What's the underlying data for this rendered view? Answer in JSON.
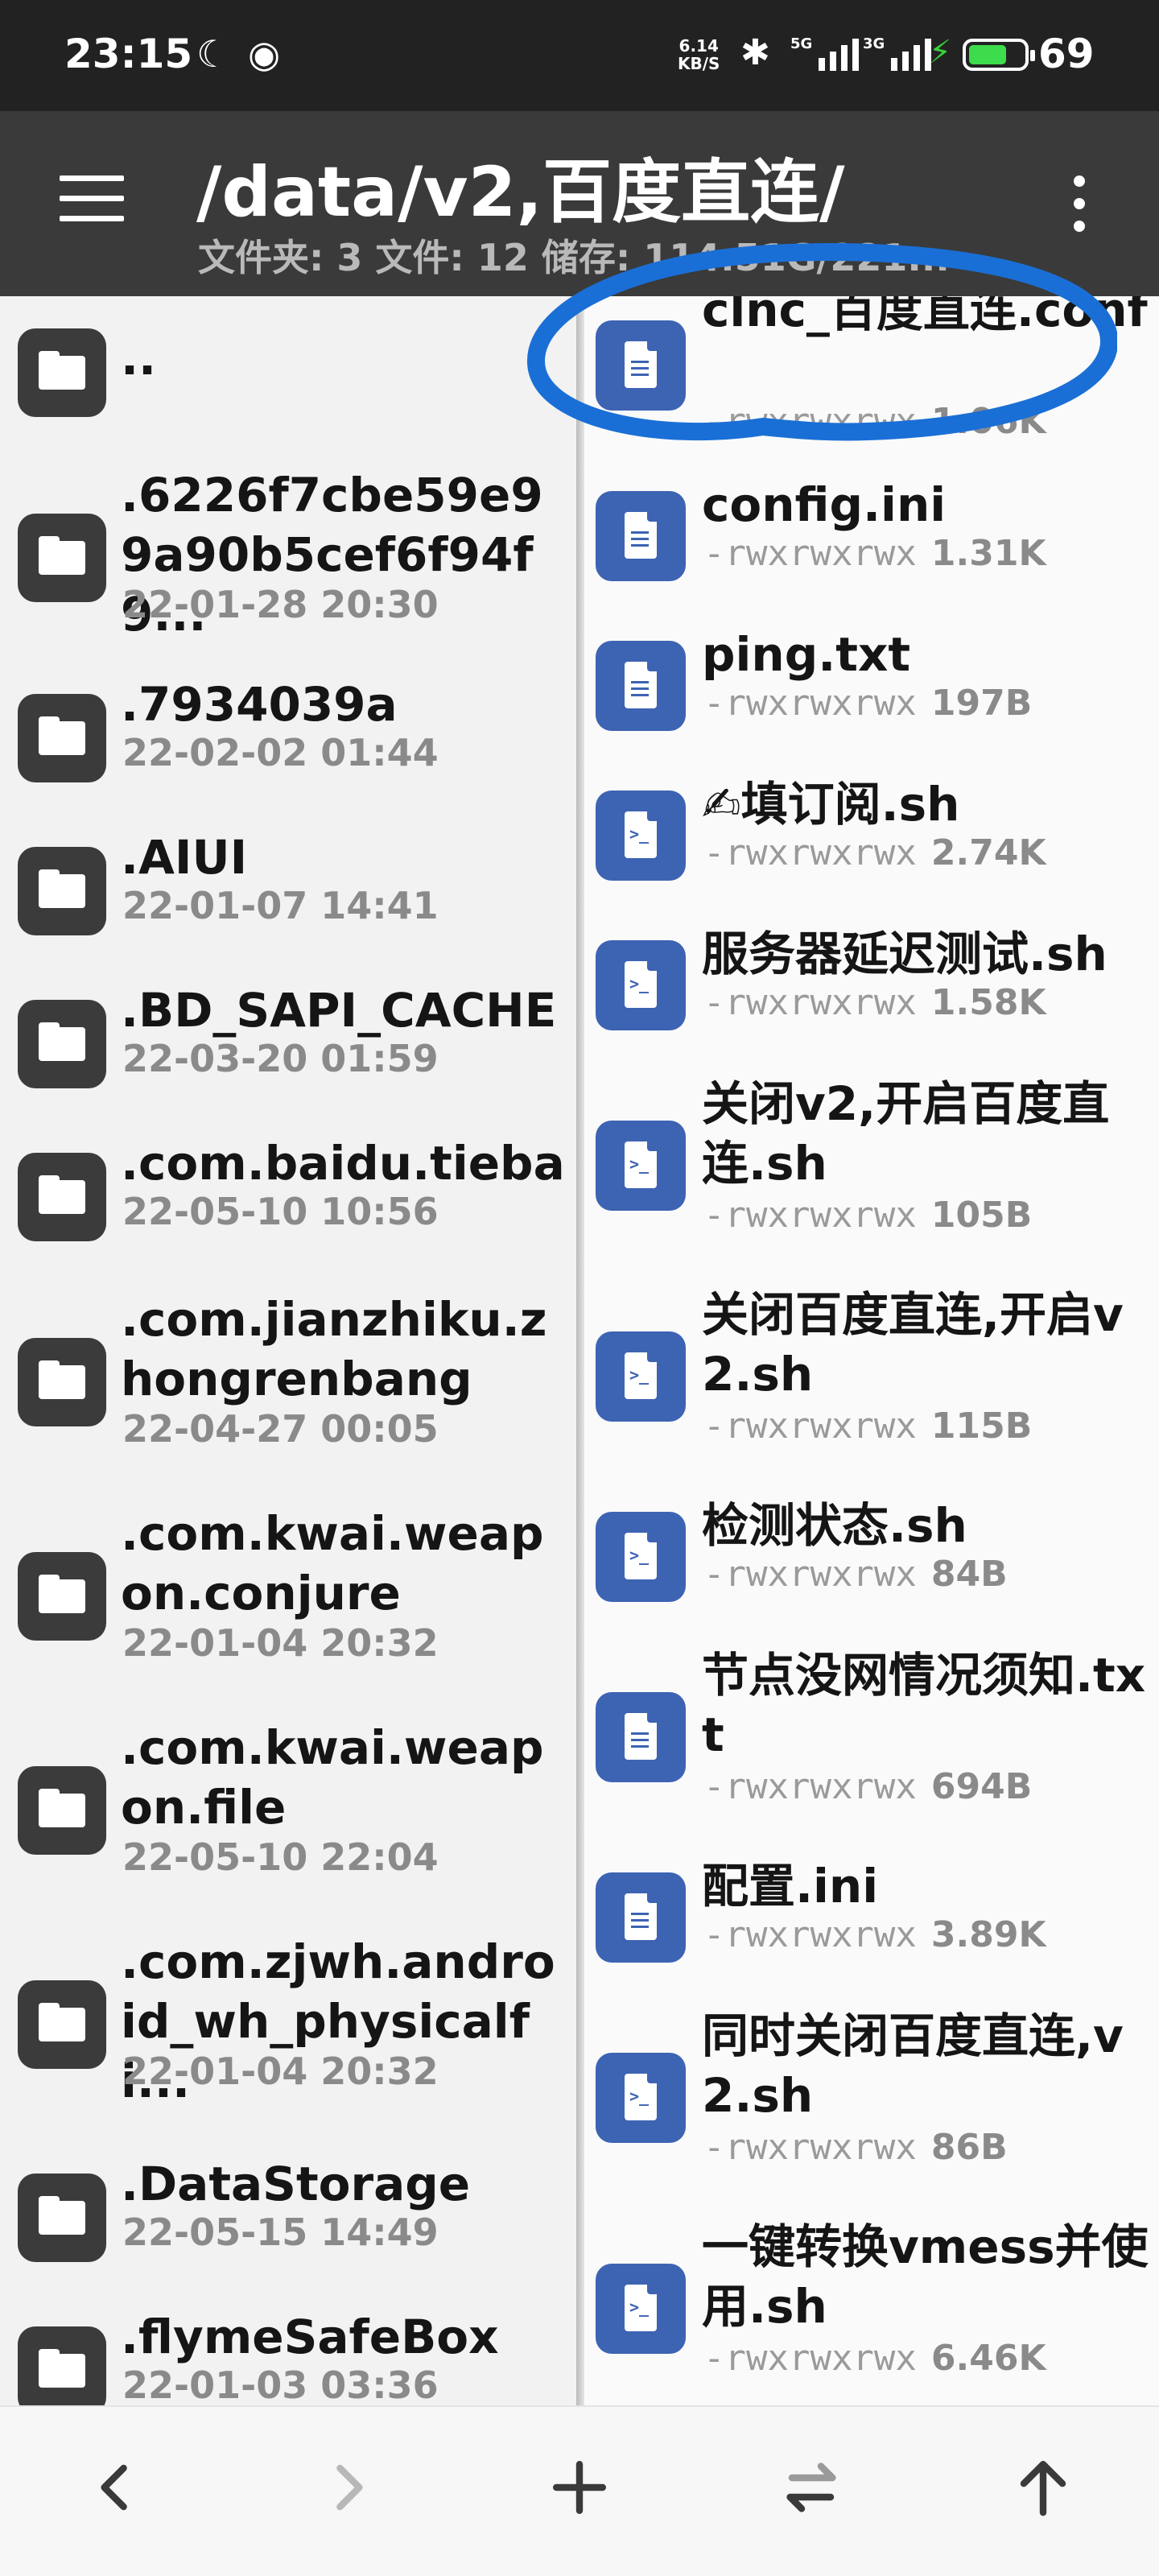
{
  "status_bar": {
    "time": "23:15",
    "net_speed_value": "6.14",
    "net_speed_unit": "KB/S",
    "sim1_label": "5G",
    "sim2_label": "3G",
    "battery_percent": "69",
    "battery_level": 0.69,
    "icons": [
      "moon-icon",
      "hotspot-icon",
      "bluetooth-icon",
      "signal-icon",
      "charging-icon",
      "battery-icon"
    ]
  },
  "app_bar": {
    "title": "/data/v2,百度直连/",
    "subtitle": "文件夹: 3  文件: 12  储存: 114.51G/221..."
  },
  "left_pane": {
    "items": [
      {
        "name": "..",
        "date": ""
      },
      {
        "name": ".6226f7cbe59e99a90b5cef6f94f9...",
        "date": "22-01-28 20:30"
      },
      {
        "name": ".7934039a",
        "date": "22-02-02 01:44"
      },
      {
        "name": ".AIUI",
        "date": "22-01-07 14:41"
      },
      {
        "name": ".BD_SAPI_CACHE",
        "date": "22-03-20 01:59"
      },
      {
        "name": ".com.baidu.tieba",
        "date": "22-05-10 10:56"
      },
      {
        "name": ".com.jianzhiku.zhongrenbang",
        "date": "22-04-27 00:05"
      },
      {
        "name": ".com.kwai.weapon.conjure",
        "date": "22-01-04 20:32"
      },
      {
        "name": ".com.kwai.weapon.file",
        "date": "22-05-10 22:04"
      },
      {
        "name": ".com.zjwh.android_wh_physicalfi...",
        "date": "22-01-04 20:32"
      },
      {
        "name": ".DataStorage",
        "date": "22-05-15 14:49"
      },
      {
        "name": ".flymeSafeBox",
        "date": "22-01-03 03:36"
      }
    ]
  },
  "right_pane": {
    "items": [
      {
        "name": "clnc_百度直连.conf",
        "perm": "-rwxrwxrwx",
        "size": "1.06K",
        "kind": "text"
      },
      {
        "name": "config.ini",
        "perm": "-rwxrwxrwx",
        "size": "1.31K",
        "kind": "text"
      },
      {
        "name": "ping.txt",
        "perm": "-rwxrwxrwx",
        "size": "197B",
        "kind": "text"
      },
      {
        "name": "✍填订阅.sh",
        "perm": "-rwxrwxrwx",
        "size": "2.74K",
        "kind": "script"
      },
      {
        "name": "服务器延迟测试.sh",
        "perm": "-rwxrwxrwx",
        "size": "1.58K",
        "kind": "script"
      },
      {
        "name": "关闭v2,开启百度直连.sh",
        "perm": "-rwxrwxrwx",
        "size": "105B",
        "kind": "script"
      },
      {
        "name": "关闭百度直连,开启v2.sh",
        "perm": "-rwxrwxrwx",
        "size": "115B",
        "kind": "script"
      },
      {
        "name": "检测状态.sh",
        "perm": "-rwxrwxrwx",
        "size": "84B",
        "kind": "script"
      },
      {
        "name": "节点没网情况须知.txt",
        "perm": "-rwxrwxrwx",
        "size": "694B",
        "kind": "text"
      },
      {
        "name": "配置.ini",
        "perm": "-rwxrwxrwx",
        "size": "3.89K",
        "kind": "text"
      },
      {
        "name": "同时关闭百度直连,v2.sh",
        "perm": "-rwxrwxrwx",
        "size": "86B",
        "kind": "script"
      },
      {
        "name": "一键转换vmess并使用.sh",
        "perm": "-rwxrwxrwx",
        "size": "6.46K",
        "kind": "script"
      }
    ]
  },
  "bottom_bar": {
    "buttons": [
      "back-icon",
      "forward-icon",
      "add-icon",
      "swap-icon",
      "up-icon"
    ]
  },
  "colors": {
    "status_bar_bg": "#222222",
    "app_bar_bg": "#3a3a3a",
    "folder_icon_bg": "#3b3b3b",
    "file_icon_bg": "#3d63b3",
    "annotation_stroke": "#1a6fd6"
  }
}
